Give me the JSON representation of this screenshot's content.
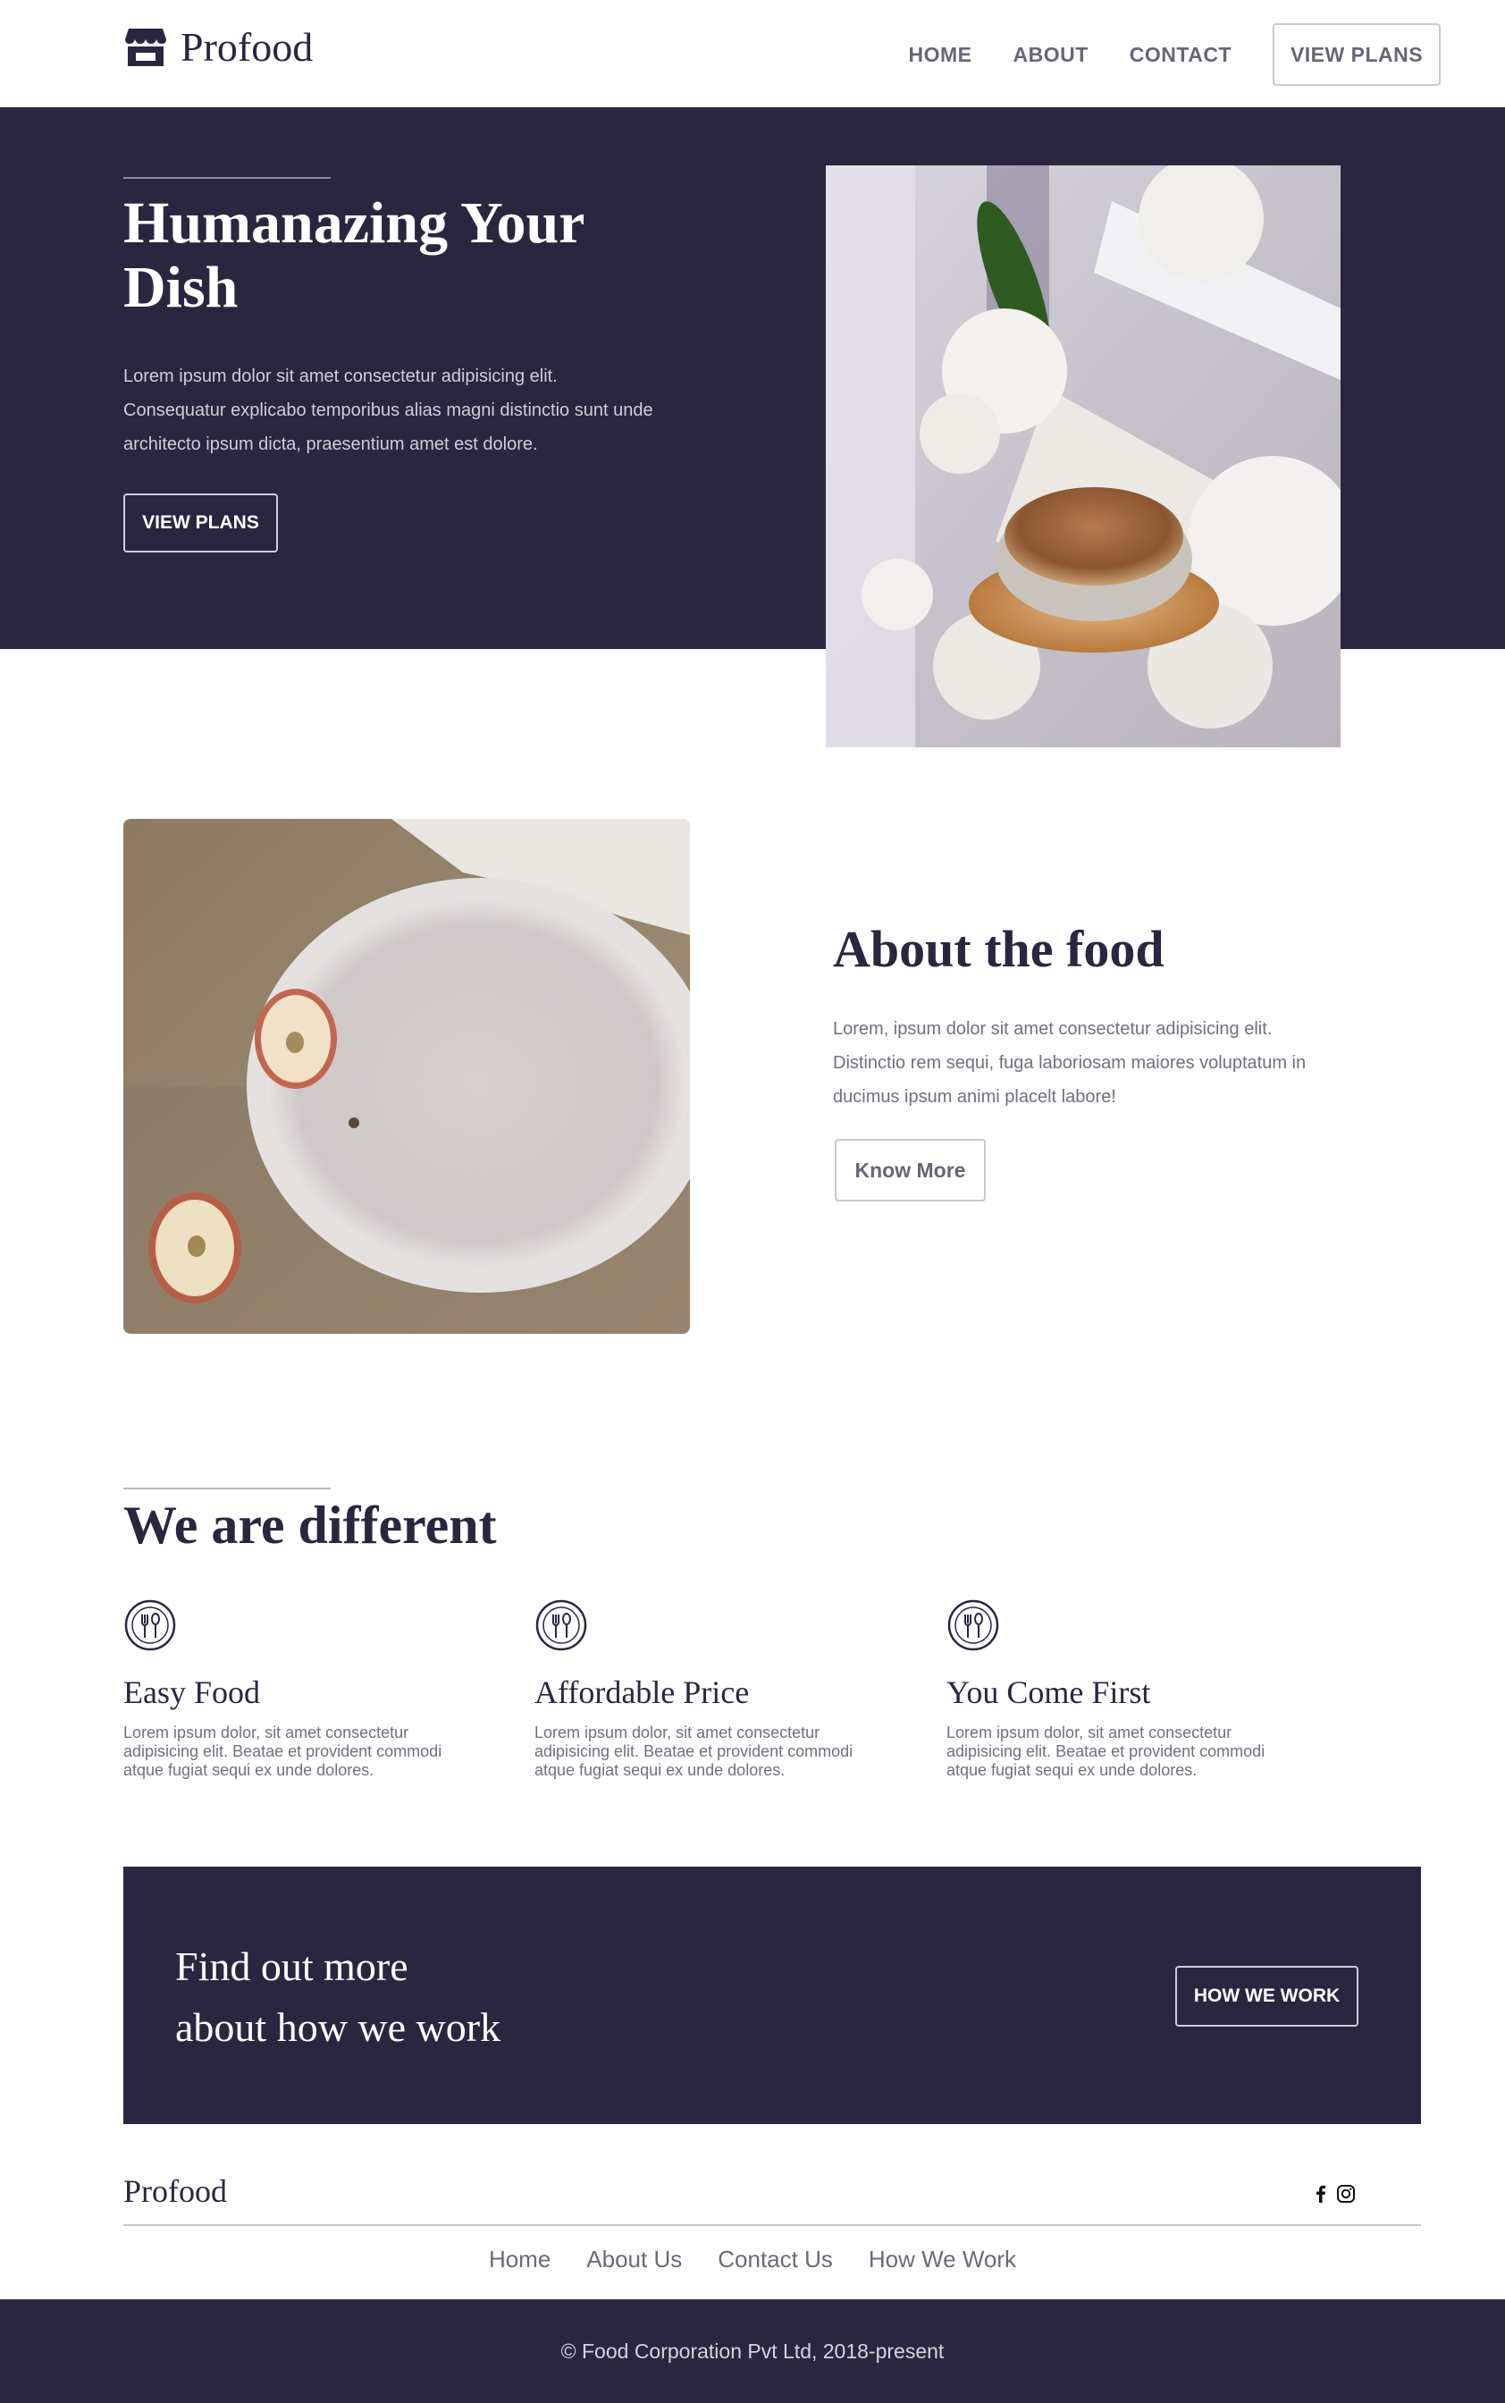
{
  "brand": {
    "name": "Profood",
    "icon": "store-icon"
  },
  "nav": {
    "links": [
      "HOME",
      "ABOUT",
      "CONTACT"
    ],
    "cta_label": "VIEW PLANS"
  },
  "hero": {
    "title": "Humanazing Your Dish",
    "text": "Lorem ipsum dolor sit amet consectetur adipisicing elit. Consequatur explicabo temporibus alias magni distinctio sunt unde architecto ipsum dicta, praesentium amet est dolore.",
    "button_label": "VIEW PLANS",
    "image": "coffee-cup-with-white-flowers-photo"
  },
  "about": {
    "title": "About the food",
    "text": "Lorem, ipsum dolor sit amet consectetur adipisicing elit. Distinctio rem sequi, fuga laboriosam maiores voluptatum in ducimus ipsum animi placelt labore!",
    "button_label": "Know More",
    "image": "white-plate-with-apple-halves-photo"
  },
  "different": {
    "title": "We are different",
    "features": [
      {
        "icon": "utensils-icon",
        "title": "Easy Food",
        "text": "Lorem ipsum dolor, sit amet consectetur adipisicing elit. Beatae et provident commodi atque fugiat sequi ex unde dolores."
      },
      {
        "icon": "utensils-icon",
        "title": "Affordable Price",
        "text": "Lorem ipsum dolor, sit amet consectetur adipisicing elit. Beatae et provident commodi atque fugiat sequi ex unde dolores."
      },
      {
        "icon": "utensils-icon",
        "title": "You Come First",
        "text": "Lorem ipsum dolor, sit amet consectetur adipisicing elit. Beatae et provident commodi atque fugiat sequi ex unde dolores."
      }
    ]
  },
  "cta": {
    "title_line1": "Find out more",
    "title_line2": "about how we work",
    "button_label": "HOW WE WORK"
  },
  "footer": {
    "brand": "Profood",
    "social": [
      "facebook-icon",
      "instagram-icon"
    ],
    "links": [
      "Home",
      "About Us",
      "Contact Us",
      "How We Work"
    ],
    "copyright": "© Food Corporation Pvt Ltd, 2018-present"
  },
  "colors": {
    "primary_dark": "#2b2640",
    "muted_text": "#707080",
    "nav_text": "#676674"
  }
}
